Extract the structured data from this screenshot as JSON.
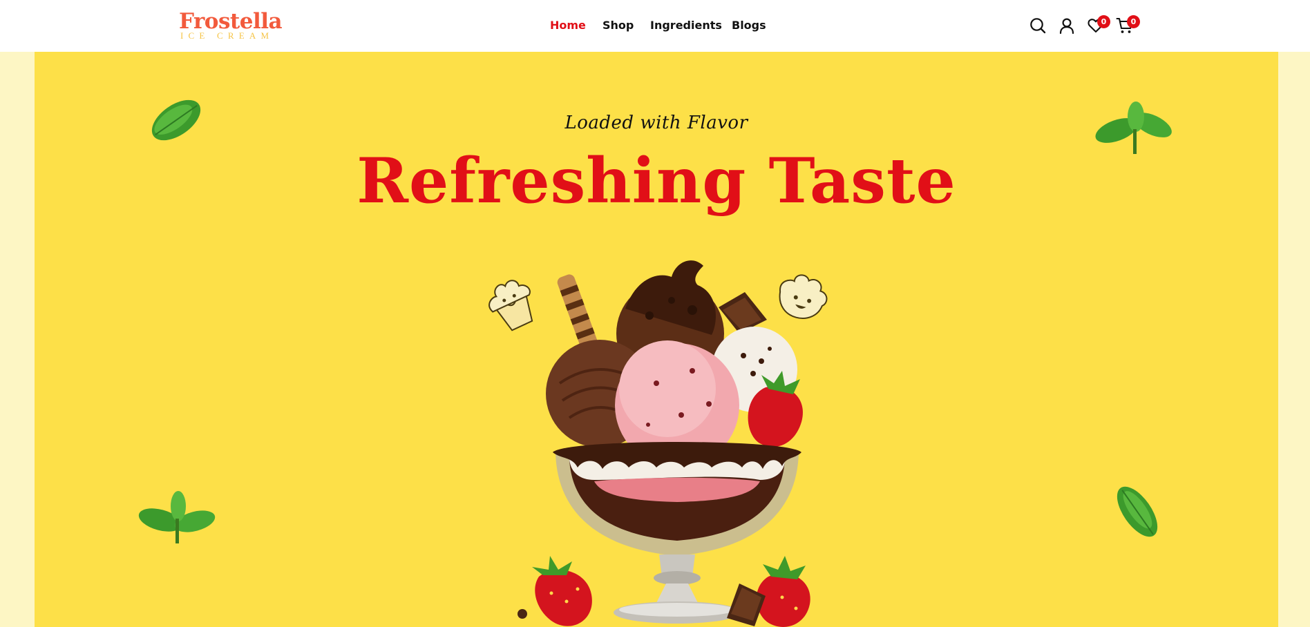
{
  "brand": {
    "name": "Frostella",
    "subtitle": "ICE CREAM"
  },
  "nav": {
    "items": [
      {
        "label": "Home",
        "active": true
      },
      {
        "label": "Shop",
        "active": false
      },
      {
        "label": "Ingredients",
        "active": false
      },
      {
        "label": "Blogs",
        "active": false
      }
    ]
  },
  "header_icons": {
    "search": "search-icon",
    "account": "user-icon",
    "wishlist": "heart-icon",
    "cart": "cart-icon",
    "wishlist_count": "0",
    "cart_count": "0"
  },
  "hero": {
    "tagline": "Loaded with Flavor",
    "headline": "Refreshing Taste"
  },
  "colors": {
    "accent": "#e10f17",
    "hero_bg": "#fde048",
    "page_bg": "#fdf6c4",
    "logo": "#f25a3c",
    "logo_sub": "#f6c445"
  }
}
